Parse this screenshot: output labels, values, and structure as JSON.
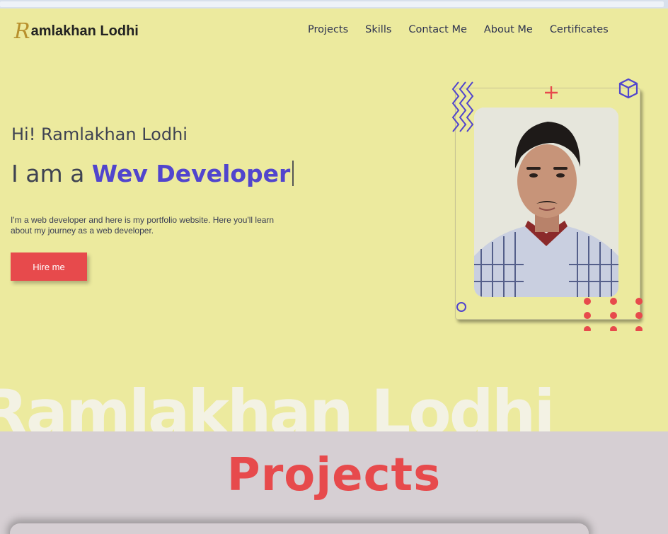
{
  "logo": {
    "initial": "R",
    "rest": "amlakhan Lodhi"
  },
  "nav": [
    "Projects",
    "Skills",
    "Contact Me",
    "About Me",
    "Certificates"
  ],
  "hero": {
    "greeting": "Hi! Ramlakhan Lodhi",
    "iam_prefix": "I am a ",
    "role": "Wev Developer",
    "description": "I'm a web developer and here is my portfolio website. Here you'll learn about my journey as a web developer.",
    "hire_button": "Hire me",
    "watermark": "Ramlakhan Lodhi"
  },
  "projects": {
    "title": "Projects"
  },
  "colors": {
    "hero_bg": "#ECEA9E",
    "accent_purple": "#5145CD",
    "accent_red": "#E74A4C",
    "section_bg": "#D6CFD3"
  },
  "icons": [
    "zigzag-icon",
    "plus-icon",
    "cube-icon",
    "circle-icon",
    "dot-grid-icon"
  ]
}
